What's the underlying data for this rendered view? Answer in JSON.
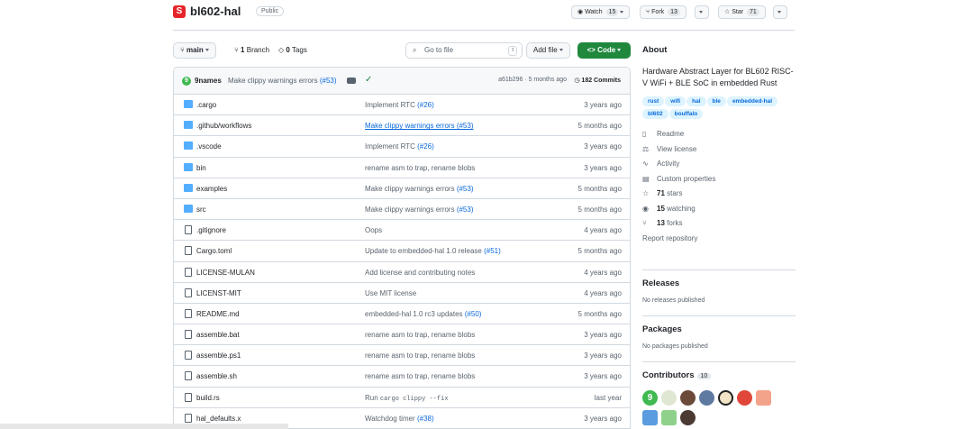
{
  "header": {
    "repo_name": "bl602-hal",
    "visibility": "Public",
    "watch_label": "Watch",
    "watch_count": "15",
    "fork_label": "Fork",
    "fork_count": "13",
    "star_label": "Star",
    "star_count": "71"
  },
  "toolbar": {
    "branch": "main",
    "branches": "1",
    "branches_label": "Branch",
    "tags": "0",
    "tags_label": "Tags",
    "goto_placeholder": "Go to file",
    "goto_kbd": "t",
    "add_file": "Add file",
    "code": "Code"
  },
  "commit": {
    "author": "9names",
    "message": "Make clippy warnings errors",
    "pr": "(#53)",
    "hash_time": "a61b296 · 5 months ago",
    "count": "182 Commits"
  },
  "files": [
    {
      "name": ".cargo",
      "type": "folder",
      "msg": "Implement RTC ",
      "pr": "(#26)",
      "date": "3 years ago"
    },
    {
      "name": ".github/workflows",
      "type": "folder",
      "msg": "Make clippy warnings errors (#53)",
      "pr": "",
      "date": "5 months ago",
      "underline": true
    },
    {
      "name": ".vscode",
      "type": "folder",
      "msg": "Implement RTC ",
      "pr": "(#26)",
      "date": "3 years ago"
    },
    {
      "name": "bin",
      "type": "folder",
      "msg": "rename asm to trap, rename blobs",
      "pr": "",
      "date": "3 years ago"
    },
    {
      "name": "examples",
      "type": "folder",
      "msg": "Make clippy warnings errors ",
      "pr": "(#53)",
      "date": "5 months ago"
    },
    {
      "name": "src",
      "type": "folder",
      "msg": "Make clippy warnings errors ",
      "pr": "(#53)",
      "date": "5 months ago"
    },
    {
      "name": ".gitignore",
      "type": "file",
      "msg": "Oops",
      "pr": "",
      "date": "4 years ago"
    },
    {
      "name": "Cargo.toml",
      "type": "file",
      "msg": "Update to embedded-hal 1.0 release ",
      "pr": "(#51)",
      "date": "5 months ago"
    },
    {
      "name": "LICENSE-MULAN",
      "type": "file",
      "msg": "Add license and contributing notes",
      "pr": "",
      "date": "4 years ago"
    },
    {
      "name": "LICENST-MIT",
      "type": "file",
      "msg": "Use MIT license",
      "pr": "",
      "date": "4 years ago"
    },
    {
      "name": "README.md",
      "type": "file",
      "msg": "embedded-hal 1.0 rc3 updates ",
      "pr": "(#50)",
      "date": "5 months ago"
    },
    {
      "name": "assemble.bat",
      "type": "file",
      "msg": "rename asm to trap, rename blobs",
      "pr": "",
      "date": "3 years ago"
    },
    {
      "name": "assemble.ps1",
      "type": "file",
      "msg": "rename asm to trap, rename blobs",
      "pr": "",
      "date": "3 years ago"
    },
    {
      "name": "assemble.sh",
      "type": "file",
      "msg": "rename asm to trap, rename blobs",
      "pr": "",
      "date": "3 years ago"
    },
    {
      "name": "build.rs",
      "type": "file",
      "msg": "Run ",
      "code": "cargo clippy --fix",
      "pr": "",
      "date": "last year"
    },
    {
      "name": "hal_defaults.x",
      "type": "file",
      "msg": "Watchdog timer ",
      "pr": "(#38)",
      "date": "3 years ago"
    }
  ],
  "about": {
    "title": "About",
    "description": "Hardware Abstract Layer for BL602 RISC-V WiFi + BLE SoC in embedded Rust",
    "topics": [
      "rust",
      "wifi",
      "hal",
      "ble",
      "embedded-hal",
      "bl602",
      "bouffalo"
    ],
    "links": [
      {
        "icon": "book-icon",
        "glyph": "▯",
        "label": "Readme"
      },
      {
        "icon": "scale-icon",
        "glyph": "⚖",
        "label": "View license"
      },
      {
        "icon": "pulse-icon",
        "glyph": "∿",
        "label": "Activity"
      },
      {
        "icon": "note-icon",
        "glyph": "▤",
        "label": "Custom properties"
      }
    ],
    "stars": "71",
    "stars_label": "stars",
    "watching": "15",
    "watching_label": "watching",
    "forks": "13",
    "forks_label": "forks",
    "report": "Report repository"
  },
  "releases": {
    "title": "Releases",
    "text": "No releases published"
  },
  "packages": {
    "title": "Packages",
    "text": "No packages published"
  },
  "contributors": {
    "title": "Contributors",
    "count": "10"
  },
  "colors": {
    "accent_green": "#1f883d",
    "link_blue": "#0969da",
    "folder_blue": "#54aeff",
    "logo_red": "#e5252a"
  }
}
